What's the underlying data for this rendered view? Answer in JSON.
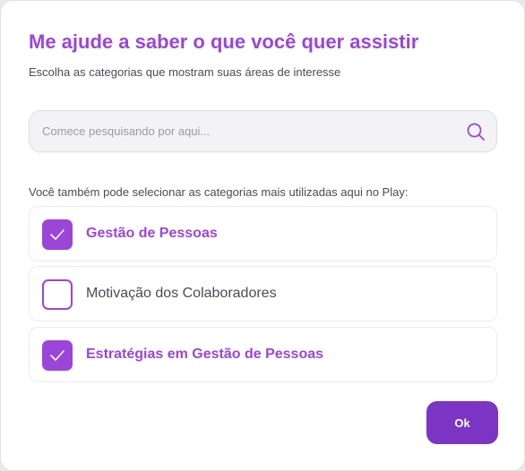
{
  "dialog": {
    "title": "Me ajude a saber o que você quer assistir",
    "subtitle": "Escolha as categorias que mostram suas áreas de interesse"
  },
  "search": {
    "placeholder": "Comece pesquisando por aqui...",
    "value": "",
    "icon": "search-icon"
  },
  "categories": {
    "hint": "Você também pode selecionar as categorias mais utilizadas aqui no Play:",
    "items": [
      {
        "label": "Gestão de Pessoas",
        "checked": true
      },
      {
        "label": "Motivação dos Colaboradores",
        "checked": false
      },
      {
        "label": "Estratégias em Gestão de Pessoas",
        "checked": true
      }
    ]
  },
  "actions": {
    "ok_label": "Ok"
  },
  "colors": {
    "accent": "#9b45d9",
    "button": "#7b34c4"
  }
}
